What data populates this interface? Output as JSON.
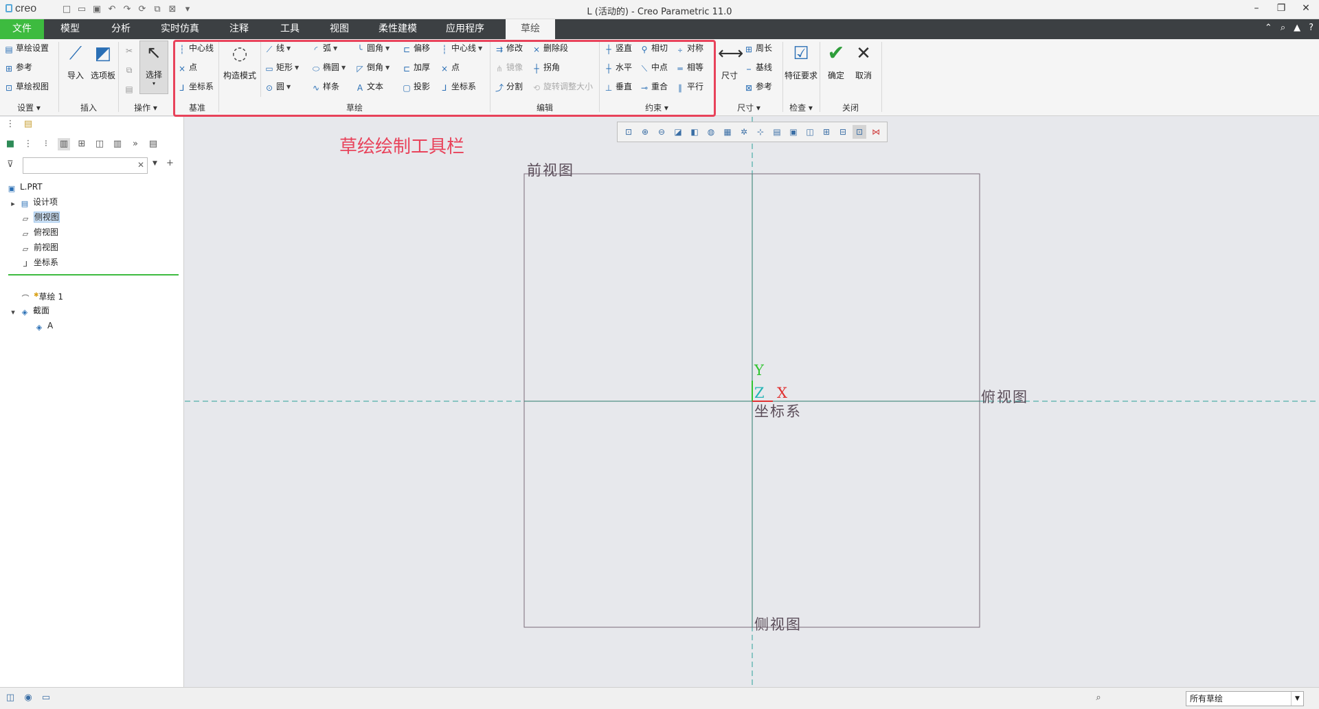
{
  "app": {
    "window_title": "L (活动的) - Creo Parametric 11.0",
    "logo_text": "creo"
  },
  "tabs": [
    {
      "label": "文件"
    },
    {
      "label": "模型"
    },
    {
      "label": "分析"
    },
    {
      "label": "实时仿真"
    },
    {
      "label": "注释"
    },
    {
      "label": "工具"
    },
    {
      "label": "视图"
    },
    {
      "label": "柔性建模"
    },
    {
      "label": "应用程序"
    },
    {
      "label": "草绘"
    }
  ],
  "ribbon": {
    "settings": {
      "label": "设置",
      "items": [
        "草绘设置",
        "参考",
        "草绘视图"
      ]
    },
    "insert": {
      "label": "插入",
      "import": "导入",
      "palette": "选项板"
    },
    "operations": {
      "label": "操作",
      "select": "选择"
    },
    "datum": {
      "label": "基准",
      "items": [
        "中心线",
        "点",
        "坐标系"
      ]
    },
    "sketch": {
      "label": "草绘",
      "construct_mode": "构造模式",
      "col1": [
        "线",
        "矩形",
        "圆"
      ],
      "col2": [
        "弧",
        "椭圆",
        "样条"
      ],
      "col3": [
        "圆角",
        "倒角",
        "文本"
      ],
      "col4": [
        "偏移",
        "加厚",
        "投影"
      ],
      "col5": [
        "中心线",
        "点",
        "坐标系"
      ]
    },
    "edit": {
      "label": "编辑",
      "col1": [
        "修改",
        "镜像",
        "分割"
      ],
      "col2": [
        "删除段",
        "拐角",
        "旋转调整大小"
      ]
    },
    "constraint": {
      "label": "约束",
      "col1": [
        "竖直",
        "水平",
        "垂直"
      ],
      "col2": [
        "相切",
        "中点",
        "重合"
      ],
      "col3": [
        "对称",
        "相等",
        "平行"
      ]
    },
    "dimension": {
      "label": "尺寸",
      "big": "尺寸",
      "items": [
        "周长",
        "基线",
        "参考"
      ]
    },
    "inspect": {
      "label": "检查",
      "big": "特征要求"
    },
    "close": {
      "label": "关闭",
      "ok": "确定",
      "cancel": "取消"
    }
  },
  "annotation": "草绘绘制工具栏",
  "tree": {
    "root": "L.PRT",
    "items": [
      "设计项",
      "侧视图",
      "俯视图",
      "前视图",
      "坐标系"
    ],
    "after": [
      "草绘 1",
      "截面",
      "A"
    ]
  },
  "canvas": {
    "labels": {
      "front": "前视图",
      "top": "俯视图",
      "side": "侧视图",
      "csys": "坐标系",
      "x": "X",
      "y": "Y",
      "z": "Z"
    }
  },
  "status": {
    "filter": "所有草绘"
  },
  "colors": {
    "accent": "#3dbb3f",
    "highlight": "#e8425a",
    "tabbar": "#3c4043"
  }
}
